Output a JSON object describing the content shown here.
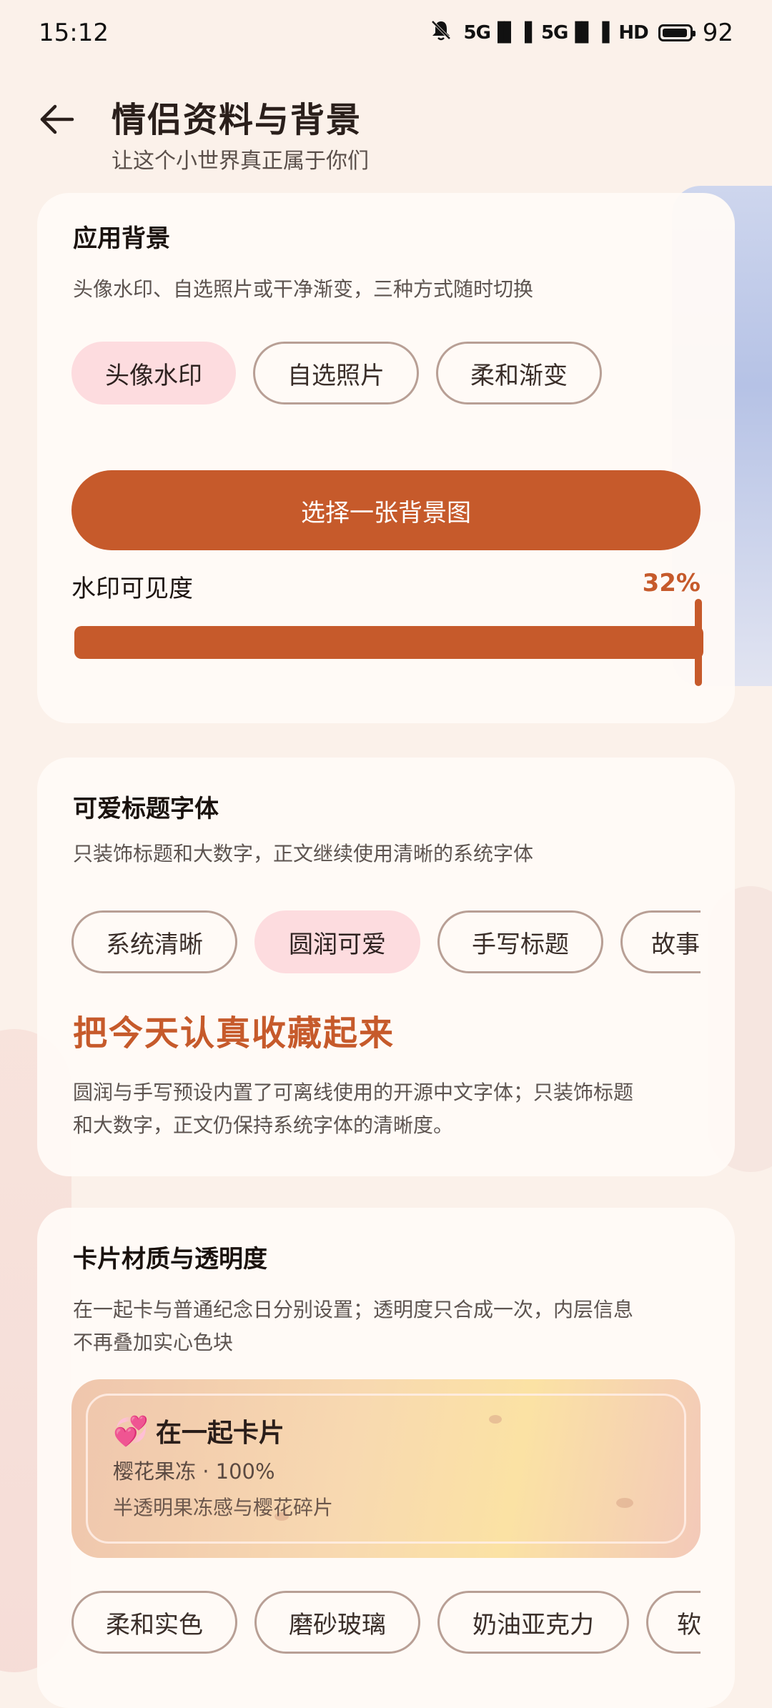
{
  "status_bar": {
    "time": "15:12",
    "signal1": "5G",
    "signal2": "5G",
    "hd": "HD",
    "battery": "92"
  },
  "header": {
    "title": "情侣资料与背景",
    "subtitle": "让这个小世界真正属于你们"
  },
  "background_card": {
    "title": "应用背景",
    "description": "头像水印、自选照片或干净渐变，三种方式随时切换",
    "options": [
      "头像水印",
      "自选照片",
      "柔和渐变"
    ],
    "selected": "头像水印",
    "choose_button": "选择一张背景图",
    "opacity_label": "水印可见度",
    "opacity_value": "32%",
    "opacity_fraction": 0.32
  },
  "font_card": {
    "title": "可爱标题字体",
    "description": "只装饰标题和大数字，正文继续使用清晰的系统字体",
    "options": [
      "系统清晰",
      "圆润可爱",
      "手写标题",
      "故事"
    ],
    "selected": "圆润可爱",
    "sample_heading": "把今天认真收藏起来",
    "sample_line1": "圆润与手写预设内置了可离线使用的开源中文字体；只装饰标题",
    "sample_line2": "和大数字，正文仍保持系统字体的清晰度。"
  },
  "material_card": {
    "title": "卡片材质与透明度",
    "description_line1": "在一起卡与普通纪念日分别设置；透明度只合成一次，内层信息",
    "description_line2": "不再叠加实心色块",
    "preview": {
      "icon": "heart-icon",
      "title": "在一起卡片",
      "meta": "樱花果冻 · 100%",
      "subtitle": "半透明果冻感与樱花碎片"
    },
    "options": [
      "柔和实色",
      "磨砂玻璃",
      "奶油亚克力",
      "软"
    ]
  },
  "colors": {
    "accent": "#c65a2b",
    "chip_active": "#fddcdf",
    "page_bg": "#fbf1ea"
  }
}
